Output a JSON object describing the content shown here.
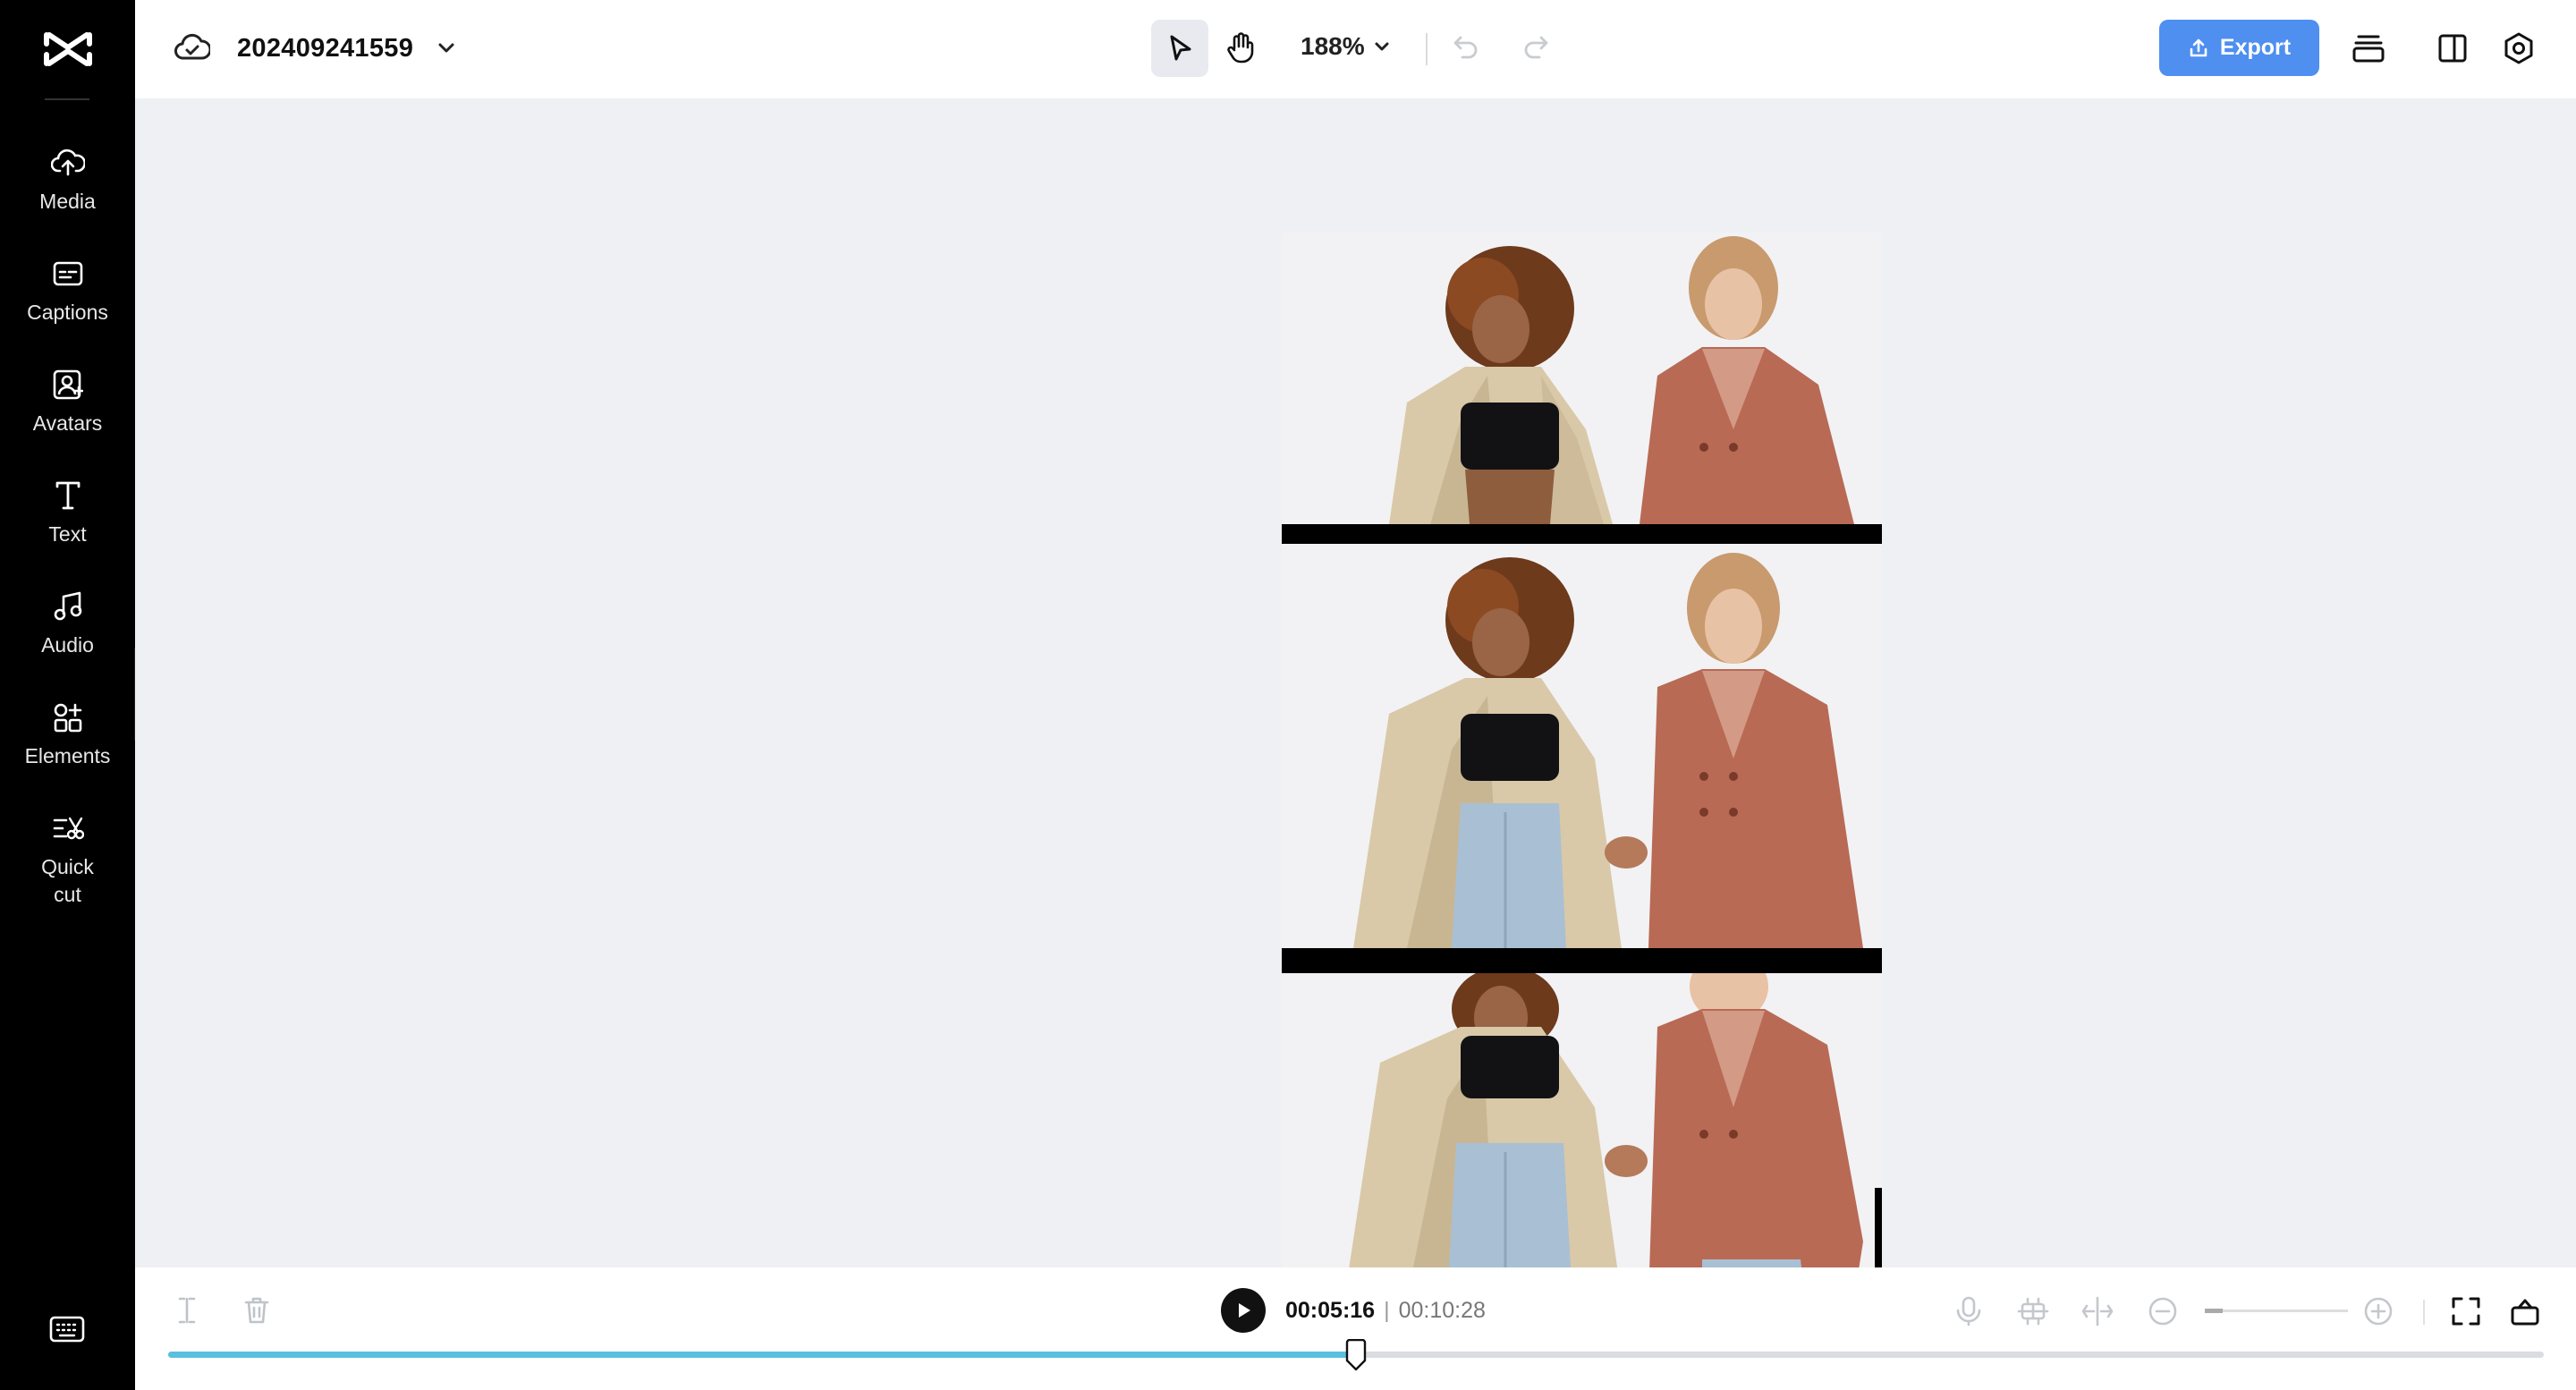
{
  "app": {
    "project_name": "202409241559",
    "zoom_level": "188%",
    "export_label": "Export"
  },
  "sidebar": {
    "items": [
      {
        "label": "Media",
        "icon": "cloud-upload-icon"
      },
      {
        "label": "Captions",
        "icon": "captions-icon"
      },
      {
        "label": "Avatars",
        "icon": "avatar-icon"
      },
      {
        "label": "Text",
        "icon": "text-icon"
      },
      {
        "label": "Audio",
        "icon": "music-note-icon"
      },
      {
        "label": "Elements",
        "icon": "elements-icon"
      },
      {
        "label": "Quick cut",
        "icon": "quick-cut-icon"
      }
    ],
    "keyboard_icon": "keyboard-icon"
  },
  "toolbar": {
    "tools": [
      "pointer-icon",
      "hand-icon"
    ],
    "undo_icon": "undo-icon",
    "redo_icon": "redo-icon",
    "right_icons": [
      "layers-icon",
      "panel-icon",
      "settings-icon"
    ]
  },
  "playback": {
    "current_time": "00:05:16",
    "separator": "|",
    "total_time": "00:10:28",
    "progress": 0.5
  },
  "colors": {
    "accent": "#4e8ff0",
    "progress": "#5ac0de",
    "rail_bg": "#000000",
    "canvas_bg": "#eef0f4"
  }
}
